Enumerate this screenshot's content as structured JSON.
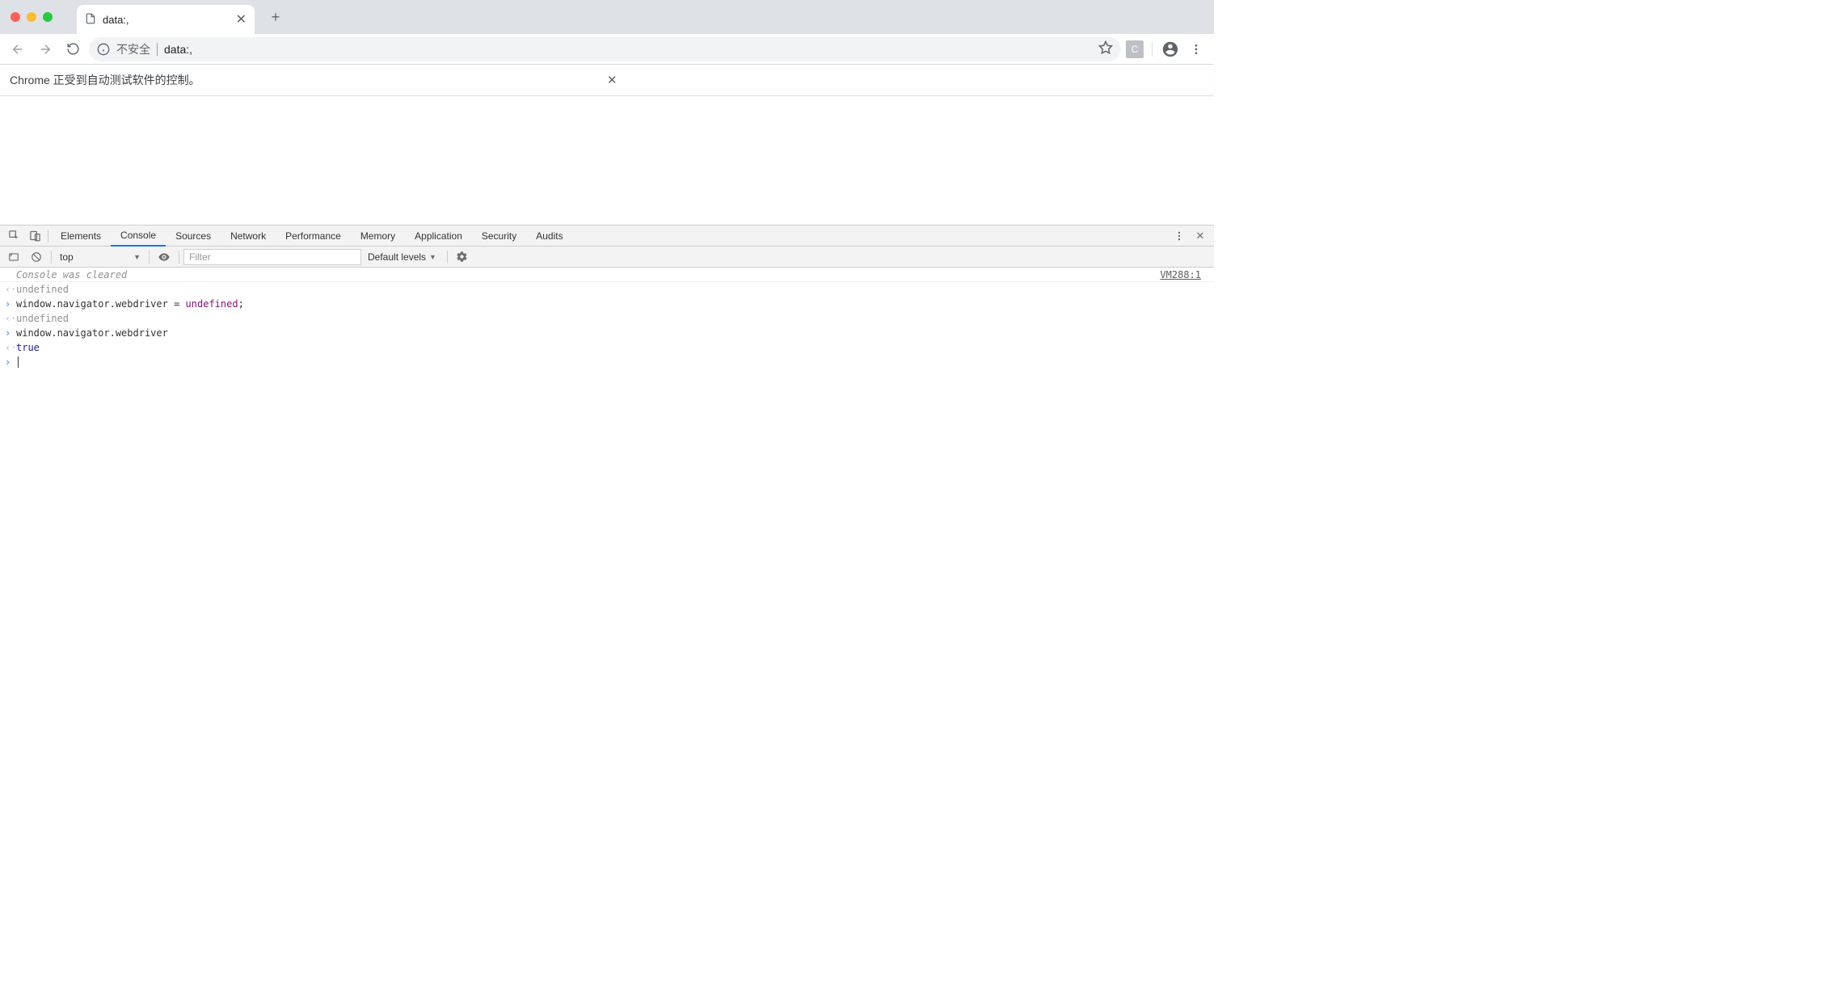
{
  "tab": {
    "title": "data:,"
  },
  "urlbar": {
    "insecure": "不安全",
    "url": "data:,"
  },
  "extension": {
    "badge": "C"
  },
  "banner": {
    "text": "Chrome 正受到自动测试软件的控制。"
  },
  "devtools": {
    "tabs": [
      "Elements",
      "Console",
      "Sources",
      "Network",
      "Performance",
      "Memory",
      "Application",
      "Security",
      "Audits"
    ],
    "activeTab": "Console",
    "ctrl": {
      "context": "top",
      "filterPlaceholder": "Filter",
      "levels": "Default levels"
    },
    "console": {
      "clearedMsg": "Console was cleared",
      "clearedRef": "VM288:1",
      "lines": [
        {
          "mark": "‹·",
          "type": "return",
          "text": "undefined"
        },
        {
          "mark": "›",
          "type": "input",
          "code": "window.navigator.webdriver = undefined;"
        },
        {
          "mark": "‹·",
          "type": "return",
          "text": "undefined"
        },
        {
          "mark": "›",
          "type": "input",
          "code": "window.navigator.webdriver"
        },
        {
          "mark": "‹·",
          "type": "return-bool",
          "text": "true"
        }
      ]
    }
  }
}
